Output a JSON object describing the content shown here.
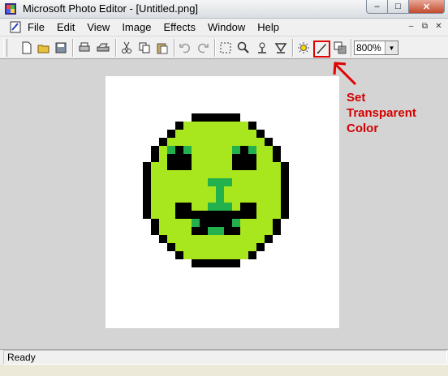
{
  "window": {
    "title": "Microsoft Photo Editor - [Untitled.png]"
  },
  "menu": {
    "items": [
      "File",
      "Edit",
      "View",
      "Image",
      "Effects",
      "Window",
      "Help"
    ]
  },
  "window_buttons": {
    "minimize": "–",
    "maximize": "□",
    "close": "✕"
  },
  "mdi_buttons": {
    "minimize": "–",
    "restore": "⧉",
    "close": "✕"
  },
  "toolbar": {
    "icons": [
      "new-icon",
      "open-icon",
      "save-icon",
      "print-icon",
      "scan-icon",
      "cut-icon",
      "copy-icon",
      "paste-icon",
      "undo-icon",
      "redo-icon",
      "select-icon",
      "zoom-icon",
      "smudge-icon",
      "sharpen-icon",
      "balance-icon",
      "set-transparent-color-icon",
      "transparency-icon"
    ],
    "zoom_value": "800%"
  },
  "annotation": {
    "line1": "Set",
    "line2": "Transparent",
    "line3": "Color"
  },
  "status": {
    "text": "Ready"
  },
  "colors": {
    "face": "#a8e61d",
    "eyes_dark": "#22b14c",
    "outline": "#000000",
    "annotation": "#d40000"
  }
}
